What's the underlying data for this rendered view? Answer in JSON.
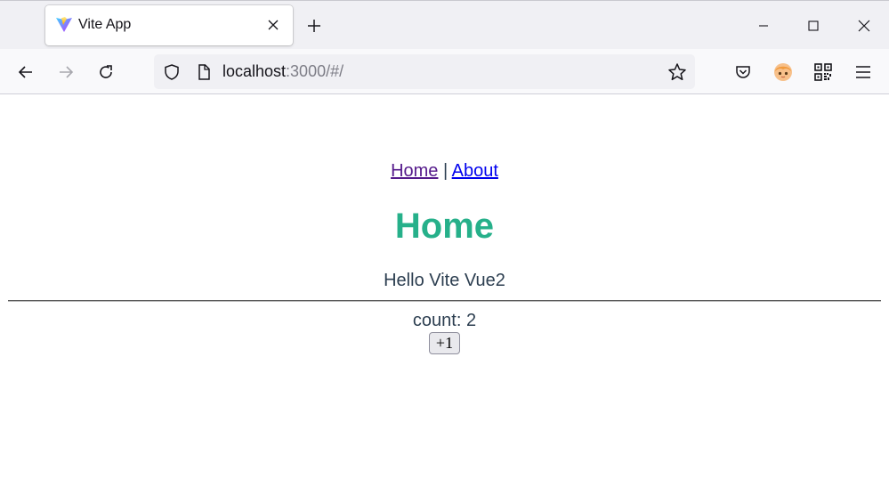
{
  "browser": {
    "tab": {
      "title": "Vite App",
      "favicon": "vite-logo-icon"
    },
    "url": {
      "host": "localhost",
      "path": ":3000/#/"
    },
    "icons": {
      "back": "arrow-left-icon",
      "forward": "arrow-right-icon",
      "reload": "reload-icon",
      "tracking": "shield-icon",
      "page": "page-icon",
      "bookmark": "star-icon",
      "pocket": "pocket-icon",
      "profile": "avatar-icon",
      "qr": "qr-code-icon",
      "menu": "hamburger-menu-icon"
    }
  },
  "page": {
    "nav": {
      "home": "Home",
      "separator": " | ",
      "about": "About"
    },
    "heading": "Home",
    "message": "Hello Vite Vue2",
    "count_label": "count: ",
    "count_value": "2",
    "button_label": "+1"
  },
  "colors": {
    "heading": "#26b08a",
    "text": "#2c3e50",
    "link": "#0000ee",
    "visited_link": "#551a8b"
  }
}
